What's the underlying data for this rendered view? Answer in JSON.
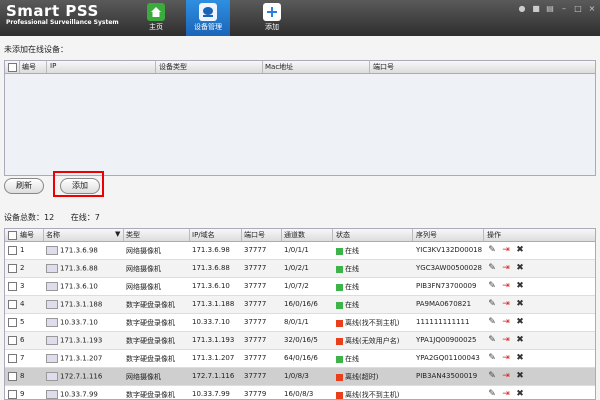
{
  "app": {
    "title": "Smart PSS",
    "subtitle": "Professional Surveillance System"
  },
  "nav": [
    {
      "label": "主页",
      "icon": "home-icon",
      "color": "#3bab3b"
    },
    {
      "label": "设备管理",
      "icon": "device-icon",
      "color": "#2a7fd8"
    },
    {
      "label": "添加",
      "icon": "plus-icon",
      "color": "#2a7fd8"
    }
  ],
  "unadded": {
    "label": "未添加在线设备：",
    "headers": [
      "编号",
      "IP",
      "设备类型",
      "Mac地址",
      "端口号"
    ]
  },
  "buttons": {
    "refresh": "刷新",
    "add": "添加"
  },
  "summary": {
    "total_label": "设备总数：",
    "total": "12",
    "online_label": "在线：",
    "online": "7"
  },
  "devices": {
    "headers": [
      "编号",
      "名称",
      "类型",
      "IP/域名",
      "端口号",
      "通道数",
      "状态",
      "序列号",
      "操作"
    ],
    "rows": [
      {
        "no": "1",
        "name": "171.3.6.98",
        "type": "网络摄像机",
        "ip": "171.3.6.98",
        "port": "37777",
        "ch": "1/0/1/1",
        "status": "在线",
        "online": true,
        "sn": "YIC3KV132D00018"
      },
      {
        "no": "2",
        "name": "171.3.6.88",
        "type": "网络摄像机",
        "ip": "171.3.6.88",
        "port": "37777",
        "ch": "1/0/2/1",
        "status": "在线",
        "online": true,
        "sn": "YGC3AW00500028"
      },
      {
        "no": "3",
        "name": "171.3.6.10",
        "type": "网络摄像机",
        "ip": "171.3.6.10",
        "port": "37777",
        "ch": "1/0/7/2",
        "status": "在线",
        "online": true,
        "sn": "PIB3FN73700009"
      },
      {
        "no": "4",
        "name": "171.3.1.188",
        "type": "数字硬盘录像机",
        "ip": "171.3.1.188",
        "port": "37777",
        "ch": "16/0/16/6",
        "status": "在线",
        "online": true,
        "sn": "PA9MA0670821"
      },
      {
        "no": "5",
        "name": "10.33.7.10",
        "type": "数字硬盘录像机",
        "ip": "10.33.7.10",
        "port": "37777",
        "ch": "8/0/1/1",
        "status": "离线(找不到主机)",
        "online": false,
        "sn": "111111111111"
      },
      {
        "no": "6",
        "name": "171.3.1.193",
        "type": "数字硬盘录像机",
        "ip": "171.3.1.193",
        "port": "37777",
        "ch": "32/0/16/5",
        "status": "离线(无效用户名)",
        "online": false,
        "sn": "YPA1JQ00900025"
      },
      {
        "no": "7",
        "name": "171.3.1.207",
        "type": "数字硬盘录像机",
        "ip": "171.3.1.207",
        "port": "37777",
        "ch": "64/0/16/6",
        "status": "在线",
        "online": true,
        "sn": "YPA2GQ01100043"
      },
      {
        "no": "8",
        "name": "172.7.1.116",
        "type": "网络摄像机",
        "ip": "172.7.1.116",
        "port": "37777",
        "ch": "1/0/8/3",
        "status": "离线(超时)",
        "online": false,
        "sn": "PIB3AN43500019"
      },
      {
        "no": "9",
        "name": "10.33.7.99",
        "type": "数字硬盘录像机",
        "ip": "10.33.7.99",
        "port": "37779",
        "ch": "16/0/8/3",
        "status": "离线(找不到主机)",
        "online": false,
        "sn": ""
      }
    ]
  },
  "colors": {
    "online": "#3cb44a",
    "offline": "#e8401c",
    "accent": "#1a64b8"
  }
}
